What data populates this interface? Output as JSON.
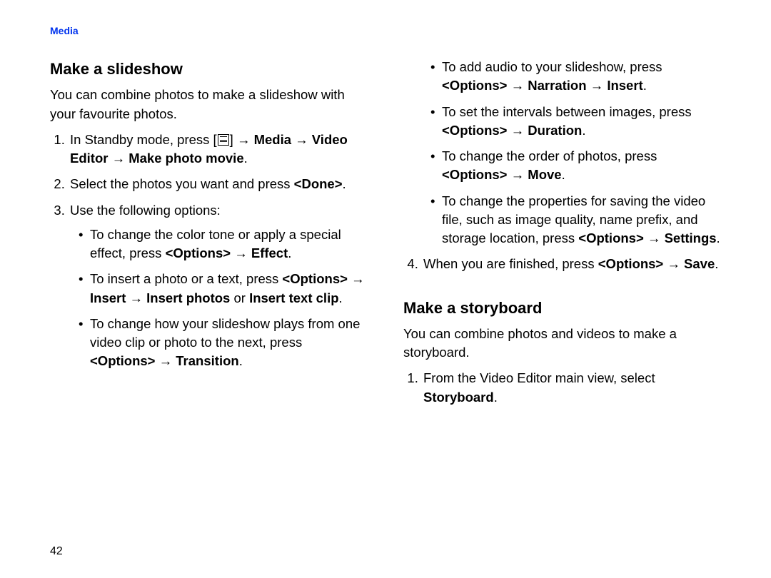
{
  "header": "Media",
  "pageNumber": "42",
  "left": {
    "title1": "Make a slideshow",
    "intro1": "You can combine photos to make a slideshow with your favourite photos.",
    "li1_a": "In Standby mode, press [",
    "li1_b": "] → ",
    "li1_c": "Media → Video Editor → Make photo movie",
    "li1_d": ".",
    "li2_a": "Select the photos you want and press ",
    "li2_b": "<Done>",
    "li2_c": ".",
    "li3": "Use the following options:",
    "b1_a": "To change the color tone or apply a special effect, press ",
    "b1_b": "<Options>",
    "b1_c": " → ",
    "b1_d": "Effect",
    "b1_e": ".",
    "b2_a": "To insert a photo or a text, press ",
    "b2_b": "<Options>",
    "b2_c": " → ",
    "b2_d": "Insert",
    "b2_e": " → ",
    "b2_f": "Insert photos",
    "b2_g": " or ",
    "b2_h": "Insert text clip",
    "b2_i": ".",
    "b3_a": "To change how your slideshow plays from one video clip or photo to the next, press ",
    "b3_b": "<Options>",
    "b3_c": " → ",
    "b3_d": "Transition",
    "b3_e": "."
  },
  "right": {
    "r1_a": "To add audio to your slideshow, press ",
    "r1_b": "<Options>",
    "r1_c": " → ",
    "r1_d": "Narration",
    "r1_e": " → ",
    "r1_f": "Insert",
    "r1_g": ".",
    "r2_a": "To set the intervals between images, press ",
    "r2_b": "<Options>",
    "r2_c": " → ",
    "r2_d": "Duration",
    "r2_e": ".",
    "r3_a": "To change the order of photos, press ",
    "r3_b": "<Options>",
    "r3_c": " → ",
    "r3_d": "Move",
    "r3_e": ".",
    "r4_a": "To change the properties for saving the video file, such as image quality, name prefix, and storage location, press ",
    "r4_b": "<Options>",
    "r4_c": " → ",
    "r4_d": "Settings",
    "r4_e": ".",
    "li4_a": "When you are finished, press ",
    "li4_b": "<Options>",
    "li4_c": " → ",
    "li4_d": "Save",
    "li4_e": ".",
    "title2": "Make a storyboard",
    "intro2": "You can combine photos and videos to make a storyboard.",
    "sb1_a": "From the Video Editor main view, select ",
    "sb1_b": "Storyboard",
    "sb1_c": "."
  }
}
